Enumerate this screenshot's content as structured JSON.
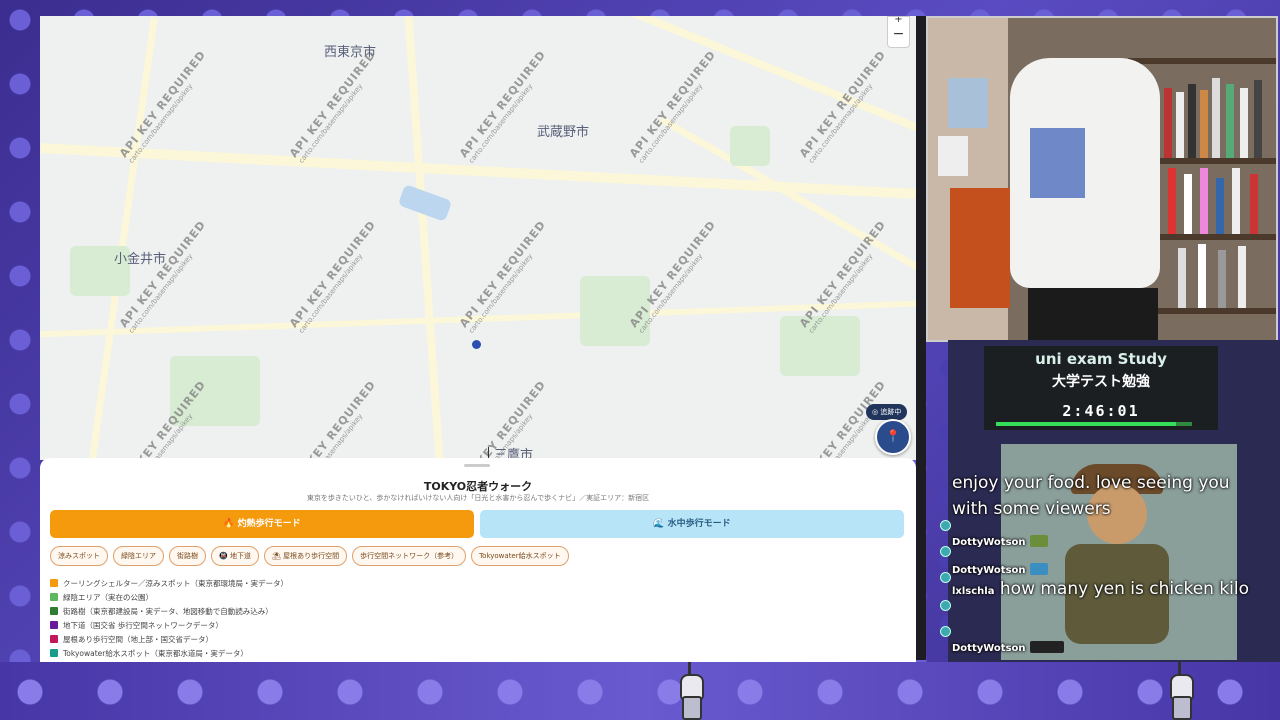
{
  "map": {
    "places": [
      "西東京市",
      "武蔵野市",
      "小金井市",
      "三鷹市"
    ],
    "watermark_title": "API KEY REQUIRED",
    "watermark_sub": "carto.com/basemaps/apikey",
    "zoom_out": "−",
    "zoom_in": "+",
    "tracking_badge": "追跡中"
  },
  "panel": {
    "title": "TOKYO忍者ウォーク",
    "subtitle": "東京を歩きたいひと、歩かなければいけない人向け「日光と水害から忍んで歩くナビ」／実証エリア：新宿区",
    "mode_heat": "灼熱歩行モード",
    "mode_water": "水中歩行モード",
    "chips": [
      "涼みスポット",
      "緑陰エリア",
      "街路樹",
      "地下道",
      "屋根あり歩行空間",
      "歩行空間ネットワーク（参考）",
      "Tokyowater給水スポット"
    ],
    "legend": [
      {
        "label": "クーリングシェルター／涼みスポット（東京都環境局・実データ）",
        "color": "#f5990d"
      },
      {
        "label": "緑陰エリア（実在の公園）",
        "color": "#5cb85c"
      },
      {
        "label": "街路樹（東京都建設局・実データ、地図移動で自動読み込み）",
        "color": "#2e7d32"
      },
      {
        "label": "地下道（国交省 歩行空間ネットワークデータ）",
        "color": "#6a1b9a"
      },
      {
        "label": "屋根あり歩行空間（地上部・国交省データ）",
        "color": "#c2185b"
      },
      {
        "label": "Tokyowater給水スポット（東京都水道局・実データ）",
        "color": "#1a9c8a"
      }
    ]
  },
  "timer": {
    "title_en": "uni exam Study",
    "title_jp": "大学テスト勉強",
    "clock": "2:46:01",
    "progress": 0.92
  },
  "chat": {
    "messages": [
      {
        "user": "",
        "text": "enjoy your food. love seeing you with some viewers"
      },
      {
        "user": "DottyWotson",
        "text": ""
      },
      {
        "user": "DottyWotson",
        "text": ""
      },
      {
        "user": "lxlschla",
        "text": "how many yen is chicken kilo"
      },
      {
        "user": "DottyWotson",
        "text": ""
      }
    ]
  },
  "colors": {
    "accent": "#f5990d",
    "water": "#b8e4f7",
    "timer_bar": "#34e05a"
  }
}
